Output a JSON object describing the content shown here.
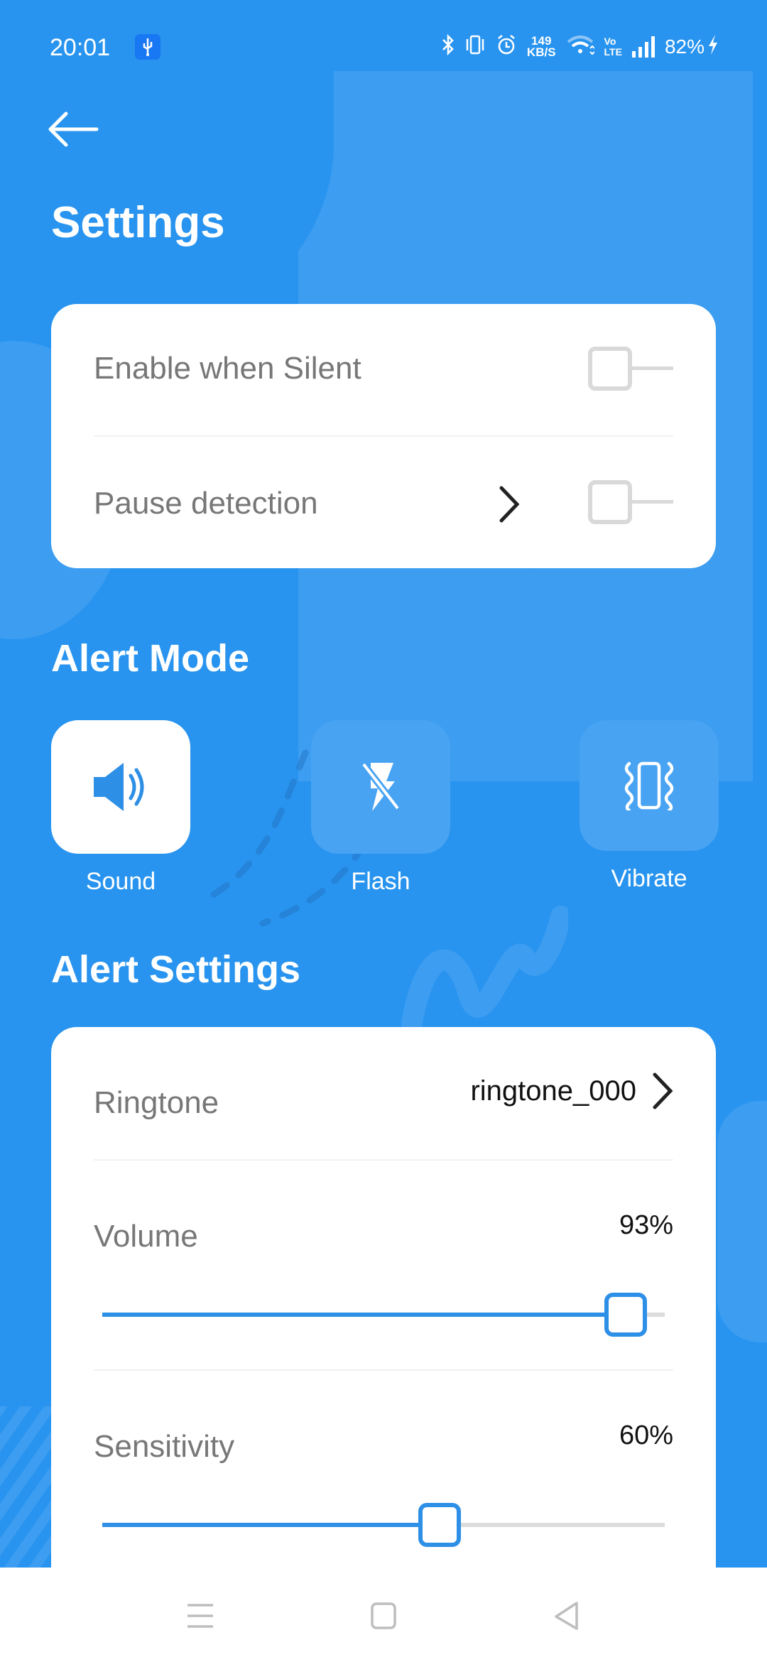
{
  "status_bar": {
    "time": "20:01",
    "usb_icon": "usb-icon",
    "network_speed_value": "149",
    "network_speed_unit": "KB/S",
    "volte_top": "Vo",
    "volte_bottom": "LTE",
    "battery": "82%",
    "icons": [
      "bluetooth-icon",
      "vibrate-icon",
      "alarm-icon",
      "wifi-icon",
      "signal-icon",
      "charging-icon"
    ]
  },
  "header": {
    "back_icon": "arrow-left-icon",
    "title": "Settings"
  },
  "general": {
    "items": [
      {
        "label": "Enable when Silent",
        "toggle": false,
        "has_chevron": false
      },
      {
        "label": "Pause detection",
        "toggle": false,
        "has_chevron": true
      }
    ]
  },
  "alert_mode": {
    "title": "Alert Mode",
    "modes": [
      {
        "label": "Sound",
        "icon": "speaker-icon",
        "selected": true
      },
      {
        "label": "Flash",
        "icon": "flash-off-icon",
        "selected": false
      },
      {
        "label": "Vibrate",
        "icon": "vibrate-icon",
        "selected": false
      }
    ]
  },
  "alert_settings": {
    "title": "Alert Settings",
    "ringtone": {
      "label": "Ringtone",
      "value": "ringtone_000"
    },
    "volume": {
      "label": "Volume",
      "value_text": "93%",
      "value": 93
    },
    "sensitivity": {
      "label": "Sensitivity",
      "value_text": "60%",
      "value": 60
    }
  },
  "colors": {
    "background": "#2894EF",
    "accent": "#2D8FE6",
    "card": "#FFFFFF"
  },
  "nav_bar": {
    "buttons": [
      "menu-icon",
      "home-icon",
      "back-triangle-icon"
    ]
  }
}
